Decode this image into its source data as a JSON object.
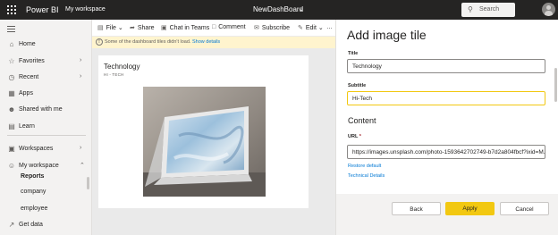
{
  "topbar": {
    "app_title": "Power BI",
    "workspace": "My workspace",
    "board_title": "NewDashBoard",
    "search_label": "Search"
  },
  "nav": {
    "items": [
      {
        "label": "Home",
        "icon": "home-icon"
      },
      {
        "label": "Favorites",
        "icon": "star-icon"
      },
      {
        "label": "Recent",
        "icon": "clock-icon"
      },
      {
        "label": "Apps",
        "icon": "apps-icon"
      },
      {
        "label": "Shared with me",
        "icon": "shared-icon"
      },
      {
        "label": "Learn",
        "icon": "book-icon"
      },
      {
        "label": "Workspaces",
        "icon": "workspaces-icon"
      },
      {
        "label": "My workspace",
        "icon": "person-icon"
      }
    ],
    "sub_items": [
      "Reports",
      "company",
      "employee"
    ],
    "get_data": "Get data"
  },
  "toolbar": {
    "file": "File",
    "share": "Share",
    "chat": "Chat in Teams",
    "comment": "Comment",
    "subscribe": "Subscribe",
    "edit": "Edit"
  },
  "warning": {
    "text": "Some of the dashboard tiles didn't load.",
    "link": "Show details"
  },
  "tile": {
    "title": "Technology",
    "subtitle": "HI - TECH"
  },
  "pane": {
    "title": "Add image tile",
    "title_label": "Title",
    "title_value": "Technology",
    "subtitle_label": "Subtitle",
    "subtitle_value": "Hi-Tech",
    "content_header": "Content",
    "url_label": "URL",
    "url_required": "*",
    "url_value": "https://images.unsplash.com/photo-1593642702749-b7d2a804fbcf?ixid=M...",
    "restore_default": "Restore default",
    "technical_details": "Technical Details",
    "back": "Back",
    "apply": "Apply",
    "cancel": "Cancel"
  },
  "colors": {
    "topbar": "#252423",
    "accent": "#f2c811",
    "link": "#0078d4"
  }
}
